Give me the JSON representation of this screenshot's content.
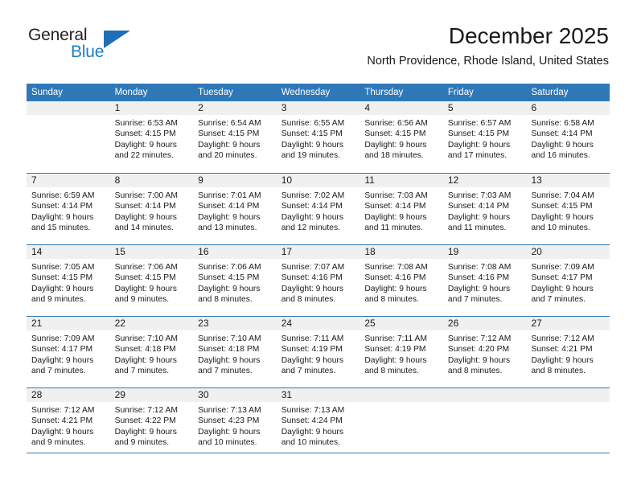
{
  "brand": {
    "name_dark": "General",
    "name_blue": "Blue",
    "accent_color": "#2e78b8"
  },
  "header": {
    "title": "December 2025",
    "subtitle": "North Providence, Rhode Island, United States"
  },
  "calendar": {
    "weekday_headers": [
      "Sunday",
      "Monday",
      "Tuesday",
      "Wednesday",
      "Thursday",
      "Friday",
      "Saturday"
    ],
    "weeks": [
      [
        {
          "day": "",
          "sunrise": "",
          "sunset": "",
          "daylight_line1": "",
          "daylight_line2": "",
          "empty": true
        },
        {
          "day": "1",
          "sunrise": "Sunrise: 6:53 AM",
          "sunset": "Sunset: 4:15 PM",
          "daylight_line1": "Daylight: 9 hours",
          "daylight_line2": "and 22 minutes."
        },
        {
          "day": "2",
          "sunrise": "Sunrise: 6:54 AM",
          "sunset": "Sunset: 4:15 PM",
          "daylight_line1": "Daylight: 9 hours",
          "daylight_line2": "and 20 minutes."
        },
        {
          "day": "3",
          "sunrise": "Sunrise: 6:55 AM",
          "sunset": "Sunset: 4:15 PM",
          "daylight_line1": "Daylight: 9 hours",
          "daylight_line2": "and 19 minutes."
        },
        {
          "day": "4",
          "sunrise": "Sunrise: 6:56 AM",
          "sunset": "Sunset: 4:15 PM",
          "daylight_line1": "Daylight: 9 hours",
          "daylight_line2": "and 18 minutes."
        },
        {
          "day": "5",
          "sunrise": "Sunrise: 6:57 AM",
          "sunset": "Sunset: 4:15 PM",
          "daylight_line1": "Daylight: 9 hours",
          "daylight_line2": "and 17 minutes."
        },
        {
          "day": "6",
          "sunrise": "Sunrise: 6:58 AM",
          "sunset": "Sunset: 4:14 PM",
          "daylight_line1": "Daylight: 9 hours",
          "daylight_line2": "and 16 minutes."
        }
      ],
      [
        {
          "day": "7",
          "sunrise": "Sunrise: 6:59 AM",
          "sunset": "Sunset: 4:14 PM",
          "daylight_line1": "Daylight: 9 hours",
          "daylight_line2": "and 15 minutes."
        },
        {
          "day": "8",
          "sunrise": "Sunrise: 7:00 AM",
          "sunset": "Sunset: 4:14 PM",
          "daylight_line1": "Daylight: 9 hours",
          "daylight_line2": "and 14 minutes."
        },
        {
          "day": "9",
          "sunrise": "Sunrise: 7:01 AM",
          "sunset": "Sunset: 4:14 PM",
          "daylight_line1": "Daylight: 9 hours",
          "daylight_line2": "and 13 minutes."
        },
        {
          "day": "10",
          "sunrise": "Sunrise: 7:02 AM",
          "sunset": "Sunset: 4:14 PM",
          "daylight_line1": "Daylight: 9 hours",
          "daylight_line2": "and 12 minutes."
        },
        {
          "day": "11",
          "sunrise": "Sunrise: 7:03 AM",
          "sunset": "Sunset: 4:14 PM",
          "daylight_line1": "Daylight: 9 hours",
          "daylight_line2": "and 11 minutes."
        },
        {
          "day": "12",
          "sunrise": "Sunrise: 7:03 AM",
          "sunset": "Sunset: 4:14 PM",
          "daylight_line1": "Daylight: 9 hours",
          "daylight_line2": "and 11 minutes."
        },
        {
          "day": "13",
          "sunrise": "Sunrise: 7:04 AM",
          "sunset": "Sunset: 4:15 PM",
          "daylight_line1": "Daylight: 9 hours",
          "daylight_line2": "and 10 minutes."
        }
      ],
      [
        {
          "day": "14",
          "sunrise": "Sunrise: 7:05 AM",
          "sunset": "Sunset: 4:15 PM",
          "daylight_line1": "Daylight: 9 hours",
          "daylight_line2": "and 9 minutes."
        },
        {
          "day": "15",
          "sunrise": "Sunrise: 7:06 AM",
          "sunset": "Sunset: 4:15 PM",
          "daylight_line1": "Daylight: 9 hours",
          "daylight_line2": "and 9 minutes."
        },
        {
          "day": "16",
          "sunrise": "Sunrise: 7:06 AM",
          "sunset": "Sunset: 4:15 PM",
          "daylight_line1": "Daylight: 9 hours",
          "daylight_line2": "and 8 minutes."
        },
        {
          "day": "17",
          "sunrise": "Sunrise: 7:07 AM",
          "sunset": "Sunset: 4:16 PM",
          "daylight_line1": "Daylight: 9 hours",
          "daylight_line2": "and 8 minutes."
        },
        {
          "day": "18",
          "sunrise": "Sunrise: 7:08 AM",
          "sunset": "Sunset: 4:16 PM",
          "daylight_line1": "Daylight: 9 hours",
          "daylight_line2": "and 8 minutes."
        },
        {
          "day": "19",
          "sunrise": "Sunrise: 7:08 AM",
          "sunset": "Sunset: 4:16 PM",
          "daylight_line1": "Daylight: 9 hours",
          "daylight_line2": "and 7 minutes."
        },
        {
          "day": "20",
          "sunrise": "Sunrise: 7:09 AM",
          "sunset": "Sunset: 4:17 PM",
          "daylight_line1": "Daylight: 9 hours",
          "daylight_line2": "and 7 minutes."
        }
      ],
      [
        {
          "day": "21",
          "sunrise": "Sunrise: 7:09 AM",
          "sunset": "Sunset: 4:17 PM",
          "daylight_line1": "Daylight: 9 hours",
          "daylight_line2": "and 7 minutes."
        },
        {
          "day": "22",
          "sunrise": "Sunrise: 7:10 AM",
          "sunset": "Sunset: 4:18 PM",
          "daylight_line1": "Daylight: 9 hours",
          "daylight_line2": "and 7 minutes."
        },
        {
          "day": "23",
          "sunrise": "Sunrise: 7:10 AM",
          "sunset": "Sunset: 4:18 PM",
          "daylight_line1": "Daylight: 9 hours",
          "daylight_line2": "and 7 minutes."
        },
        {
          "day": "24",
          "sunrise": "Sunrise: 7:11 AM",
          "sunset": "Sunset: 4:19 PM",
          "daylight_line1": "Daylight: 9 hours",
          "daylight_line2": "and 7 minutes."
        },
        {
          "day": "25",
          "sunrise": "Sunrise: 7:11 AM",
          "sunset": "Sunset: 4:19 PM",
          "daylight_line1": "Daylight: 9 hours",
          "daylight_line2": "and 8 minutes."
        },
        {
          "day": "26",
          "sunrise": "Sunrise: 7:12 AM",
          "sunset": "Sunset: 4:20 PM",
          "daylight_line1": "Daylight: 9 hours",
          "daylight_line2": "and 8 minutes."
        },
        {
          "day": "27",
          "sunrise": "Sunrise: 7:12 AM",
          "sunset": "Sunset: 4:21 PM",
          "daylight_line1": "Daylight: 9 hours",
          "daylight_line2": "and 8 minutes."
        }
      ],
      [
        {
          "day": "28",
          "sunrise": "Sunrise: 7:12 AM",
          "sunset": "Sunset: 4:21 PM",
          "daylight_line1": "Daylight: 9 hours",
          "daylight_line2": "and 9 minutes."
        },
        {
          "day": "29",
          "sunrise": "Sunrise: 7:12 AM",
          "sunset": "Sunset: 4:22 PM",
          "daylight_line1": "Daylight: 9 hours",
          "daylight_line2": "and 9 minutes."
        },
        {
          "day": "30",
          "sunrise": "Sunrise: 7:13 AM",
          "sunset": "Sunset: 4:23 PM",
          "daylight_line1": "Daylight: 9 hours",
          "daylight_line2": "and 10 minutes."
        },
        {
          "day": "31",
          "sunrise": "Sunrise: 7:13 AM",
          "sunset": "Sunset: 4:24 PM",
          "daylight_line1": "Daylight: 9 hours",
          "daylight_line2": "and 10 minutes."
        },
        {
          "day": "",
          "sunrise": "",
          "sunset": "",
          "daylight_line1": "",
          "daylight_line2": "",
          "empty": true
        },
        {
          "day": "",
          "sunrise": "",
          "sunset": "",
          "daylight_line1": "",
          "daylight_line2": "",
          "empty": true
        },
        {
          "day": "",
          "sunrise": "",
          "sunset": "",
          "daylight_line1": "",
          "daylight_line2": "",
          "empty": true
        }
      ]
    ]
  }
}
